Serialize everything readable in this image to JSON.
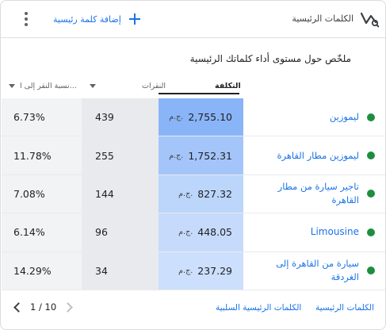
{
  "header": {
    "title": "الكلمات الرئيسية",
    "add_label": "إضافة كلمة رئيسية",
    "icon": "keywords-icon",
    "more_icon": "more-vert-icon",
    "add_icon": "plus-icon"
  },
  "subtitle": "ملخّص حول مستوى أداء كلماتك الرئيسية",
  "columns": {
    "cost": "التكلفة",
    "clicks": "النقرات",
    "conv_rate": "نسبة النقر إلى ا..."
  },
  "currency": "ج.م.",
  "rows": [
    {
      "keyword": "ليموزين",
      "cost": "2,755.10",
      "clicks": "439",
      "conv_rate": "6.73%",
      "status": "enabled"
    },
    {
      "keyword": "ليموزين مطار القاهرة",
      "cost": "1,752.31",
      "clicks": "255",
      "conv_rate": "11.78%",
      "status": "enabled"
    },
    {
      "keyword": "تاجير سيارة من مطار القاهرة",
      "cost": "827.32",
      "clicks": "144",
      "conv_rate": "7.08%",
      "status": "enabled"
    },
    {
      "keyword": "Limousine",
      "cost": "448.05",
      "clicks": "96",
      "conv_rate": "6.14%",
      "status": "enabled"
    },
    {
      "keyword": "سيارة من القاهرة إلى الغردقة",
      "cost": "237.29",
      "clicks": "34",
      "conv_rate": "14.29%",
      "status": "enabled"
    }
  ],
  "cost_heat": [
    1.0,
    0.64,
    0.3,
    0.16,
    0.09
  ],
  "footer": {
    "link_keywords": "الكلمات الرئيسية",
    "link_negative": "الكلمات الرئيسية السلبية",
    "pager": "1 / 10"
  },
  "colors": {
    "accent": "#1a73e8",
    "status_green": "#1e8e3e",
    "heat_high": "#8ab4f8",
    "heat_low": "#d2e3fc"
  }
}
